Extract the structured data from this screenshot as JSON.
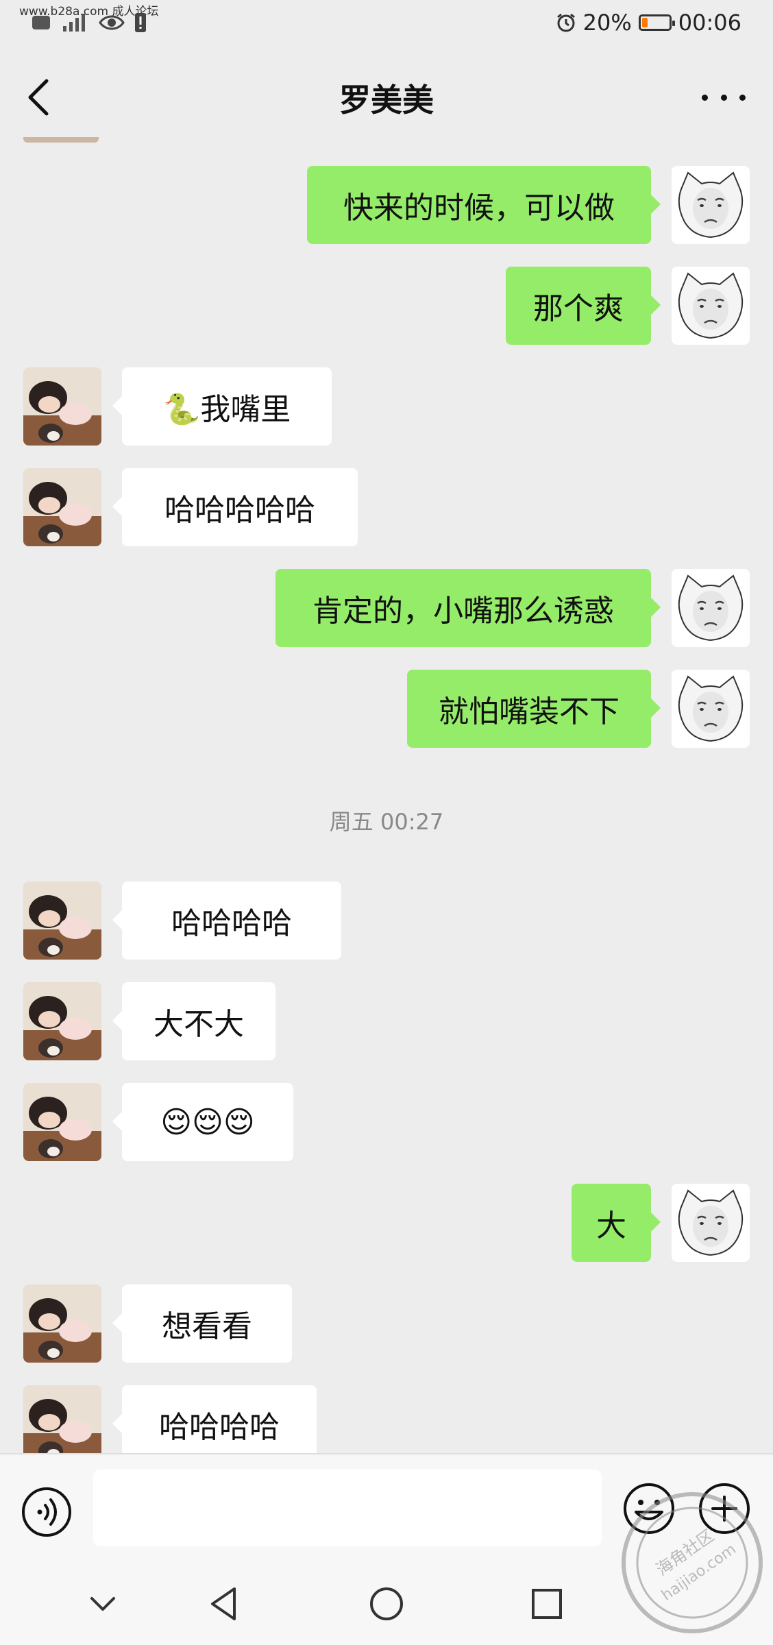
{
  "status_bar": {
    "watermark": "www.b28a.com 成人论坛",
    "battery_percent": "20%",
    "battery_level": 0.2,
    "battery_color": "#ff7a00",
    "time": "00:06",
    "icons": [
      "notification-icon",
      "signal-icon",
      "eye-icon",
      "alert-icon",
      "alarm-icon",
      "battery-icon"
    ]
  },
  "header": {
    "title": "罗美美",
    "back_icon": "back-chevron-icon",
    "more_icon": "more-dots-icon"
  },
  "chat": {
    "messages": [
      {
        "side": "out",
        "text": "快来的时候，可以做"
      },
      {
        "side": "out",
        "text": "那个爽"
      },
      {
        "side": "in",
        "text": "🐍我嘴里"
      },
      {
        "side": "in",
        "text": "哈哈哈哈哈"
      },
      {
        "side": "out",
        "text": "肯定的，小嘴那么诱惑"
      },
      {
        "side": "out",
        "text": "就怕嘴装不下"
      },
      {
        "side": "in",
        "text": "哈哈哈哈"
      },
      {
        "side": "in",
        "text": "大不大"
      },
      {
        "side": "in",
        "text": "😌😌😌"
      },
      {
        "side": "out",
        "text": "大"
      },
      {
        "side": "in",
        "text": "想看看"
      },
      {
        "side": "in",
        "text": "哈哈哈哈"
      }
    ],
    "timestamp": "周五 00:27",
    "colors": {
      "outgoing_bubble": "#95ec69",
      "incoming_bubble": "#ffffff",
      "background": "#ededed"
    }
  },
  "input_bar": {
    "text_value": "",
    "icons": [
      "voice-icon",
      "emoji-icon",
      "plus-icon"
    ]
  },
  "nav_bar": {
    "icons": [
      "hide-keyboard-icon",
      "back-triangle-icon",
      "home-circle-icon",
      "recents-square-icon"
    ]
  },
  "stamp": {
    "text_line1": "海角社区",
    "text_line2": "haijiao.com"
  }
}
